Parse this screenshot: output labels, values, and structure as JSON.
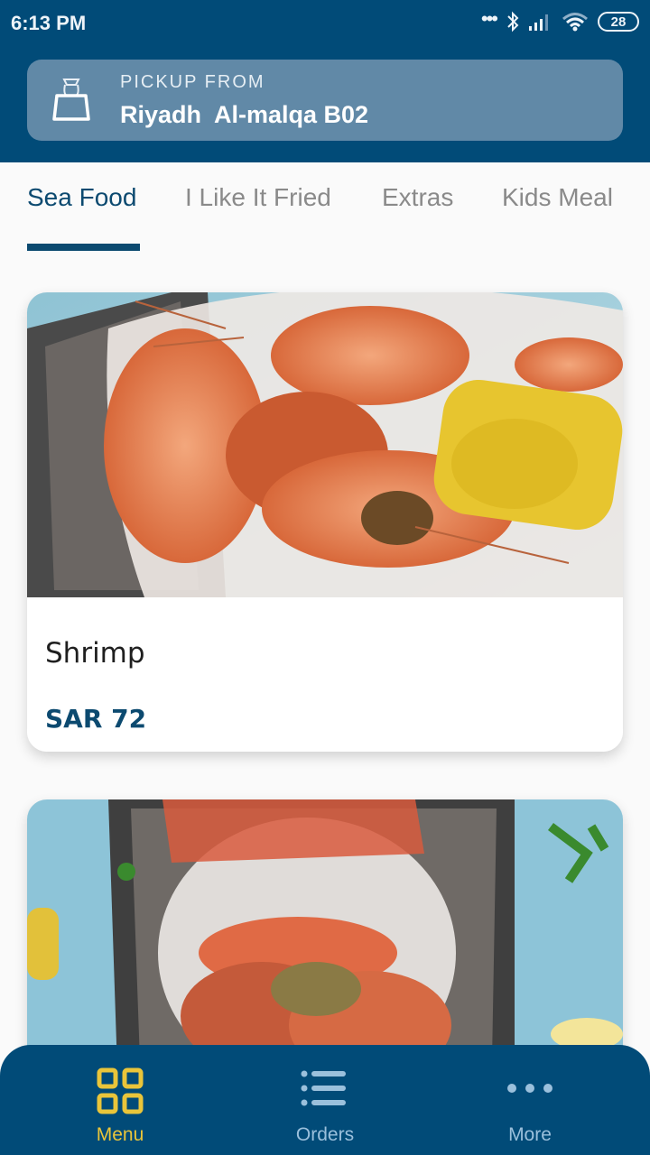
{
  "status_bar": {
    "time": "6:13 PM",
    "battery": "28",
    "icons": [
      "more-dots-icon",
      "bluetooth-icon",
      "signal-icon",
      "wifi-icon",
      "battery-icon"
    ]
  },
  "pickup": {
    "label": "PICKUP FROM",
    "location": "Riyadh  Al-malqa B02",
    "icon": "shopping-bag-icon"
  },
  "tabs": [
    {
      "label": "Sea Food",
      "active": true
    },
    {
      "label": "I Like It Fried",
      "active": false
    },
    {
      "label": "Extras",
      "active": false
    },
    {
      "label": "Kids Meal",
      "active": false
    }
  ],
  "menu_items": [
    {
      "name": "Shrimp",
      "price": "SAR 72",
      "image": "shrimp-boil-photo"
    },
    {
      "name": "",
      "price": "",
      "image": "crab-boil-photo"
    }
  ],
  "bottom_nav": [
    {
      "label": "Menu",
      "icon": "grid-icon",
      "active": true
    },
    {
      "label": "Orders",
      "icon": "list-icon",
      "active": false
    },
    {
      "label": "More",
      "icon": "more-horizontal-icon",
      "active": false
    }
  ],
  "colors": {
    "primary": "#014b78",
    "accent": "#e9c53a",
    "pickup_bg": "#6189a7",
    "tab_active": "#0c4a70",
    "tab_inactive": "#8a8a8a"
  }
}
